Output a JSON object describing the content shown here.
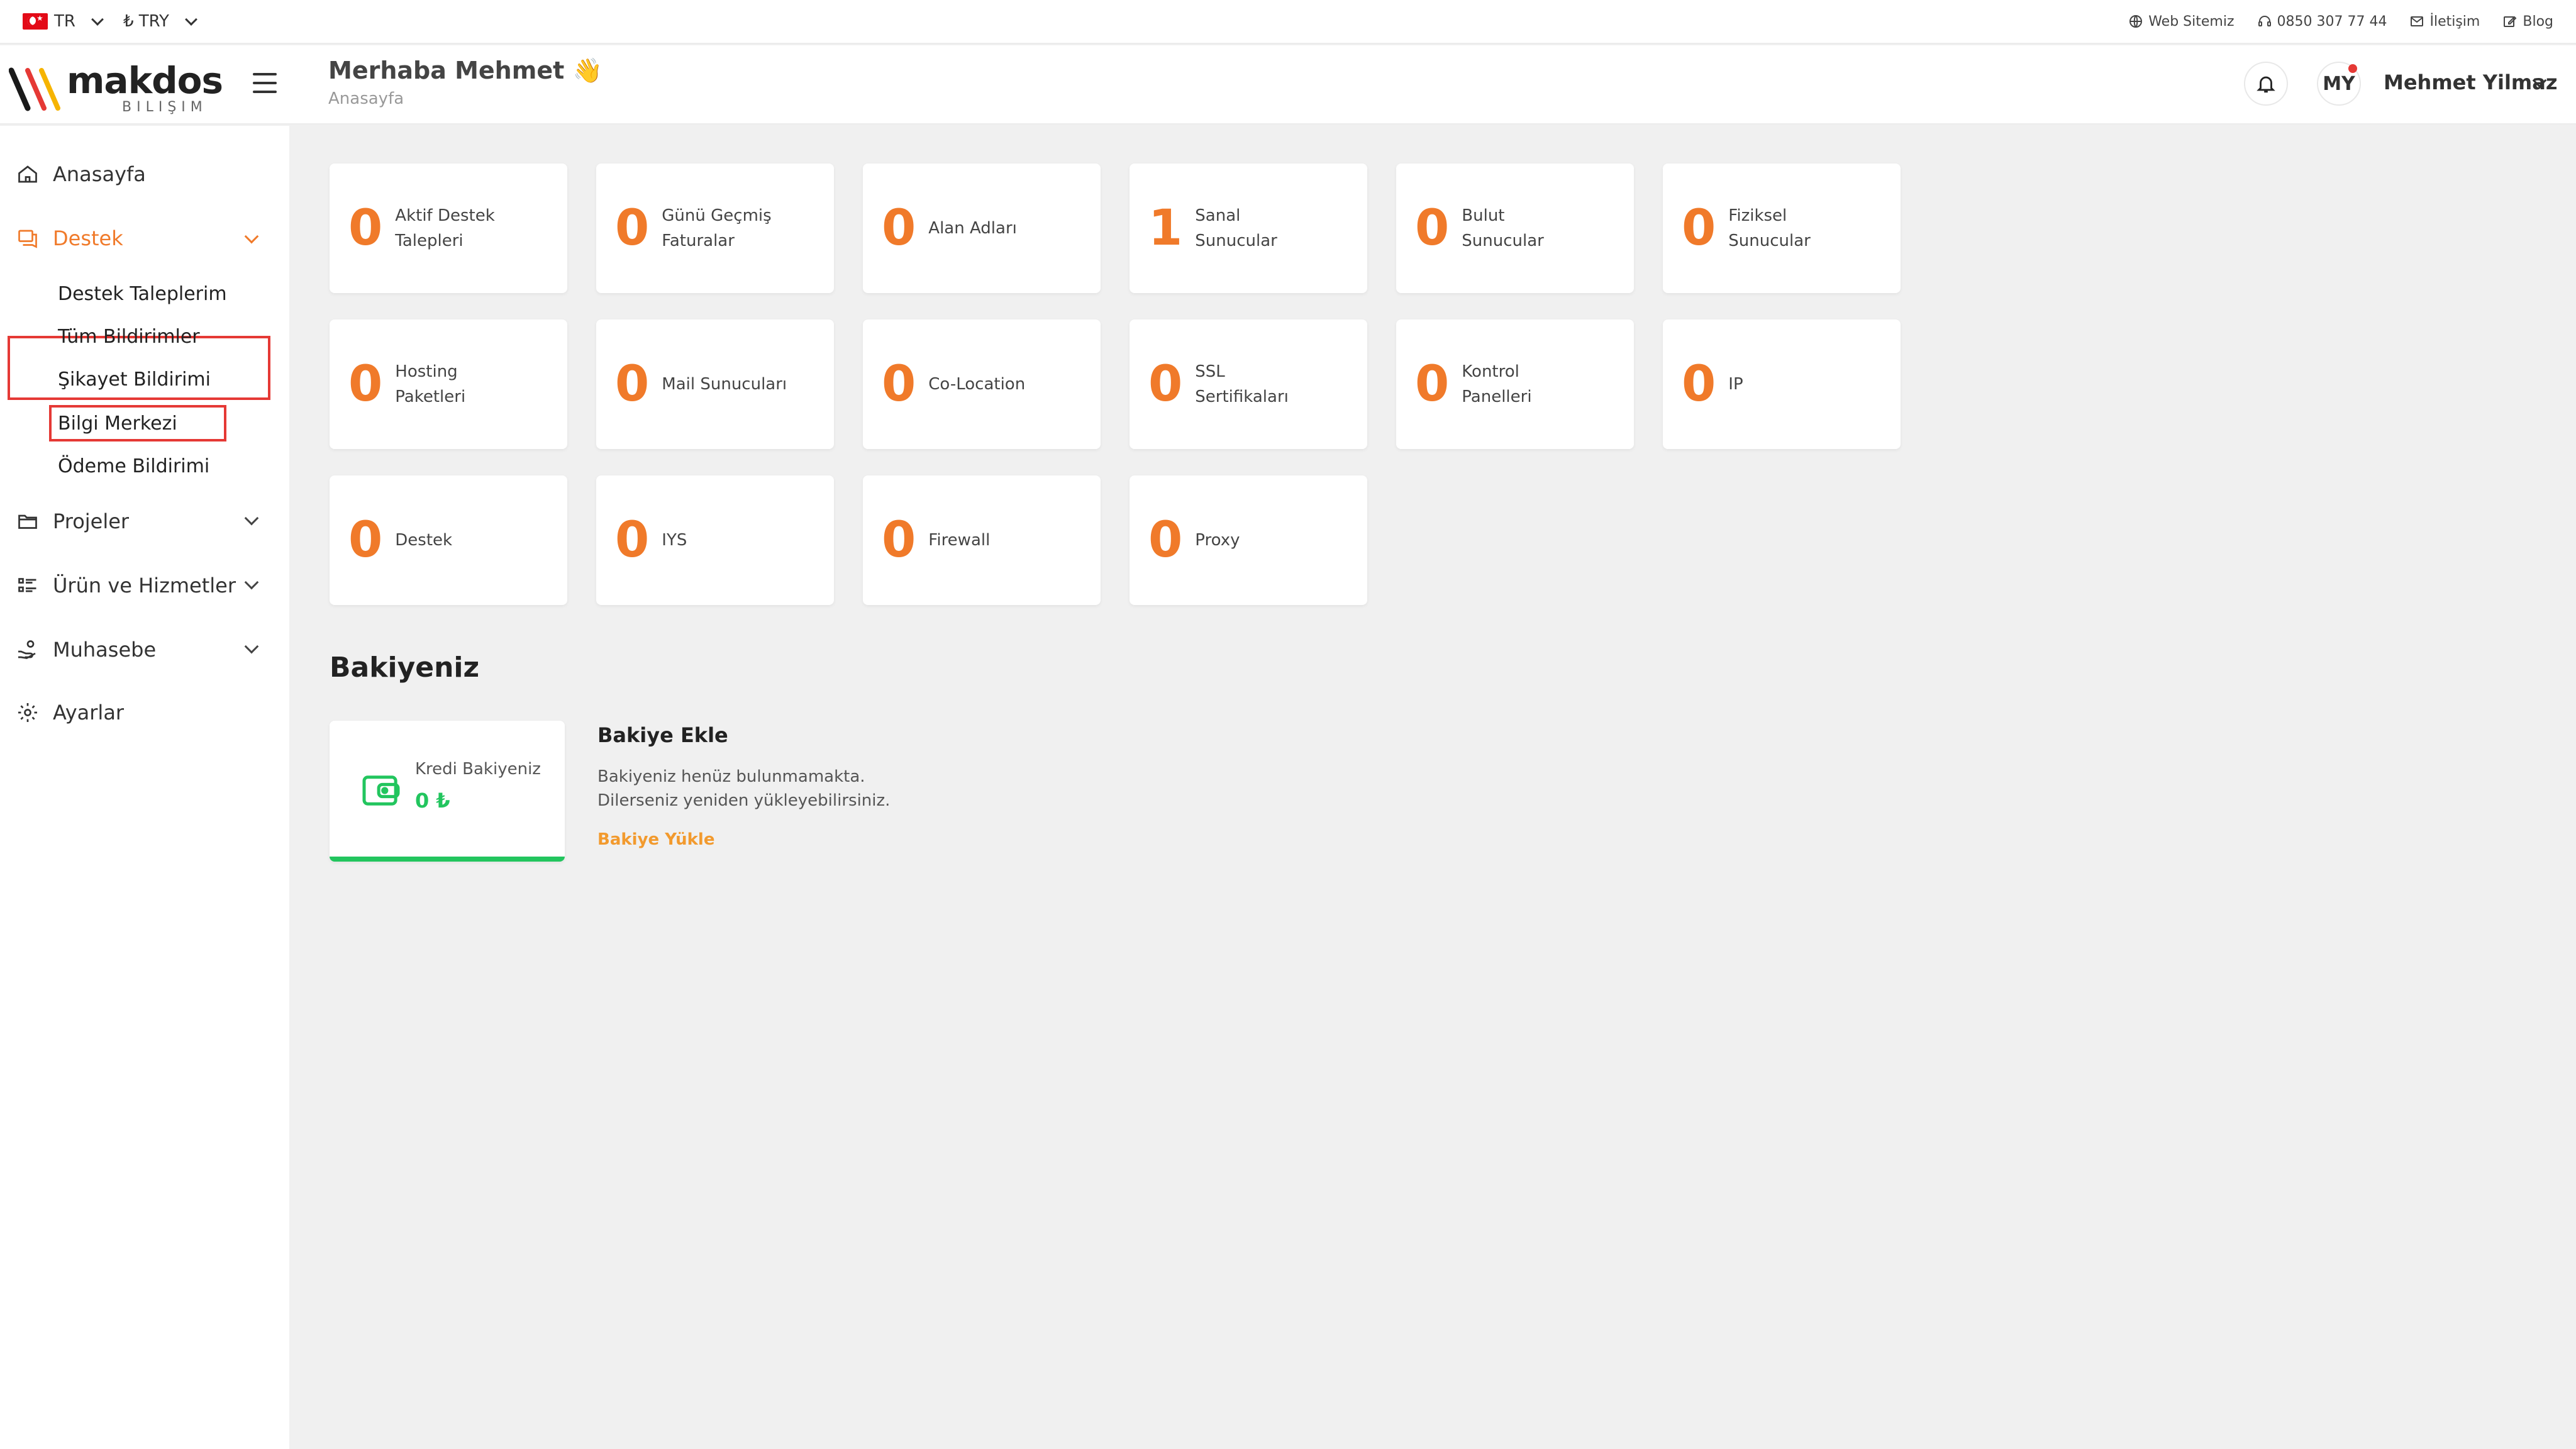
{
  "topbar": {
    "language": "TR",
    "currency": "₺ TRY",
    "links": [
      {
        "label": "Web Sitemiz",
        "icon": "globe-icon"
      },
      {
        "label": "0850 307 77 44",
        "icon": "headset-icon"
      },
      {
        "label": "İletişim",
        "icon": "mail-icon"
      },
      {
        "label": "Blog",
        "icon": "edit-icon"
      }
    ]
  },
  "header": {
    "logo_text": "makdos",
    "logo_sub": "BILIŞIM",
    "greeting": "Merhaba Mehmet 👋",
    "breadcrumb": "Anasayfa",
    "avatar_initials": "MY",
    "user_name": "Mehmet Yilmaz"
  },
  "sidebar": {
    "items": [
      {
        "label": "Anasayfa",
        "icon": "home-icon"
      },
      {
        "label": "Destek",
        "icon": "support-icon"
      },
      {
        "label": "Projeler",
        "icon": "folder-icon"
      },
      {
        "label": "Ürün ve Hizmetler",
        "icon": "list-icon"
      },
      {
        "label": "Muhasebe",
        "icon": "hand-coins-icon"
      },
      {
        "label": "Ayarlar",
        "icon": "gear-icon"
      }
    ],
    "destek_sub": [
      {
        "label": "Destek Taleplerim"
      },
      {
        "label": "Tüm Bildirimler"
      },
      {
        "label": "Şikayet Bildirimi"
      },
      {
        "label": "Bilgi Merkezi"
      },
      {
        "label": "Ödeme Bildirimi"
      }
    ]
  },
  "stats": [
    {
      "value": "0",
      "label": "Aktif Destek Talepleri"
    },
    {
      "value": "0",
      "label": "Günü Geçmiş Faturalar"
    },
    {
      "value": "0",
      "label": "Alan Adları"
    },
    {
      "value": "1",
      "label": "Sanal Sunucular"
    },
    {
      "value": "0",
      "label": "Bulut Sunucular"
    },
    {
      "value": "0",
      "label": "Fiziksel Sunucular"
    },
    {
      "value": "0",
      "label": "Hosting Paketleri"
    },
    {
      "value": "0",
      "label": "Mail Sunucuları"
    },
    {
      "value": "0",
      "label": "Co-Location"
    },
    {
      "value": "0",
      "label": "SSL Sertifikaları"
    },
    {
      "value": "0",
      "label": "Kontrol Panelleri"
    },
    {
      "value": "0",
      "label": "IP"
    },
    {
      "value": "0",
      "label": "Destek"
    },
    {
      "value": "0",
      "label": "IYS"
    },
    {
      "value": "0",
      "label": "Firewall"
    },
    {
      "value": "0",
      "label": "Proxy"
    }
  ],
  "balance": {
    "section_title": "Bakiyeniz",
    "credit_label": "Kredi Bakiyeniz",
    "credit_value": "0 ₺",
    "add_title": "Bakiye Ekle",
    "add_desc_line1": "Bakiyeniz henüz bulunmamakta.",
    "add_desc_line2": "Dilerseniz yeniden yükleyebilirsiniz.",
    "add_link": "Bakiye Yükle"
  },
  "colors": {
    "accent_orange": "#f07a2a",
    "balance_green": "#22c55e",
    "highlight_red": "#e53935",
    "link_orange": "#f29a2e"
  }
}
